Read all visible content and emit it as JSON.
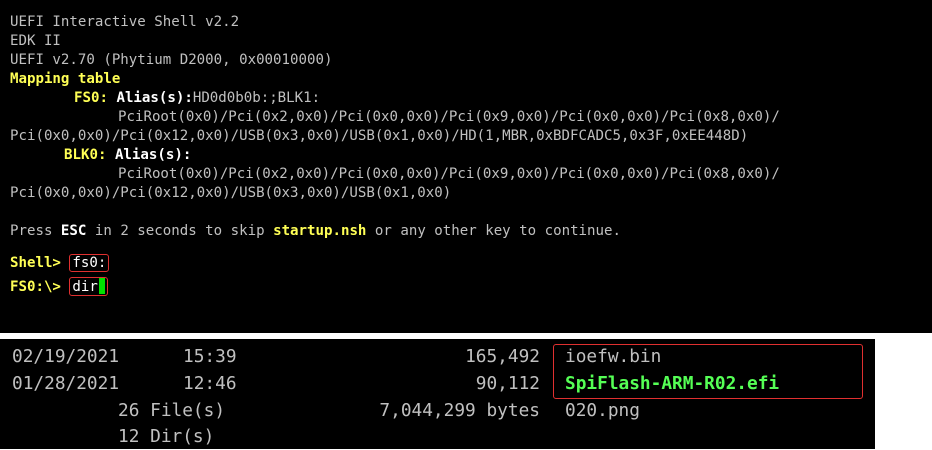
{
  "shell": {
    "title": "UEFI Interactive Shell v2.2",
    "edk": "EDK II",
    "uefi_version": "UEFI v2.70 (Phytium D2000, 0x00010000)",
    "mapping_header": "Mapping table",
    "fs0_name": "FS0:",
    "fs0_alias_label": "Alias(s):",
    "fs0_alias_value": "HD0d0b0b:;BLK1:",
    "fs0_path_1": "PciRoot(0x0)/Pci(0x2,0x0)/Pci(0x0,0x0)/Pci(0x9,0x0)/Pci(0x0,0x0)/Pci(0x8,0x0)/",
    "fs0_path_2": "Pci(0x0,0x0)/Pci(0x12,0x0)/USB(0x3,0x0)/USB(0x1,0x0)/HD(1,MBR,0xBDFCADC5,0x3F,0xEE448D)",
    "blk0_name": "BLK0:",
    "blk0_alias_label": "Alias(s):",
    "blk0_path_1": "PciRoot(0x0)/Pci(0x2,0x0)/Pci(0x0,0x0)/Pci(0x9,0x0)/Pci(0x0,0x0)/Pci(0x8,0x0)/",
    "blk0_path_2": "Pci(0x0,0x0)/Pci(0x12,0x0)/USB(0x3,0x0)/USB(0x1,0x0)",
    "press_prefix": "Press ",
    "press_key": "ESC",
    "press_middle": " in 2 seconds to skip ",
    "press_file": "startup.nsh",
    "press_suffix": " or any other key to continue.",
    "prompt_1": "Shell>",
    "command_1": "fs0:",
    "prompt_2": "FS0:\\>",
    "command_2": "dir"
  },
  "listing": {
    "rows": [
      {
        "date": "02/19/2021",
        "time": "15:39",
        "size": "165,492",
        "name": "ioefw.bin"
      },
      {
        "date": "01/28/2021",
        "time": "12:46",
        "size": "90,112",
        "name": "SpiFlash-ARM-R02.efi"
      }
    ],
    "file_count": "26 File(s)",
    "total_bytes": "7,044,299 bytes",
    "trailing_name": "020.png",
    "dir_count": "12 Dir(s)"
  },
  "colors": {
    "background": "#000000",
    "text": "#c0c0c0",
    "highlight_yellow": "#ffff55",
    "efi_green": "#55ff55",
    "cursor_green": "#00e000",
    "annotation_red": "#e03030"
  }
}
